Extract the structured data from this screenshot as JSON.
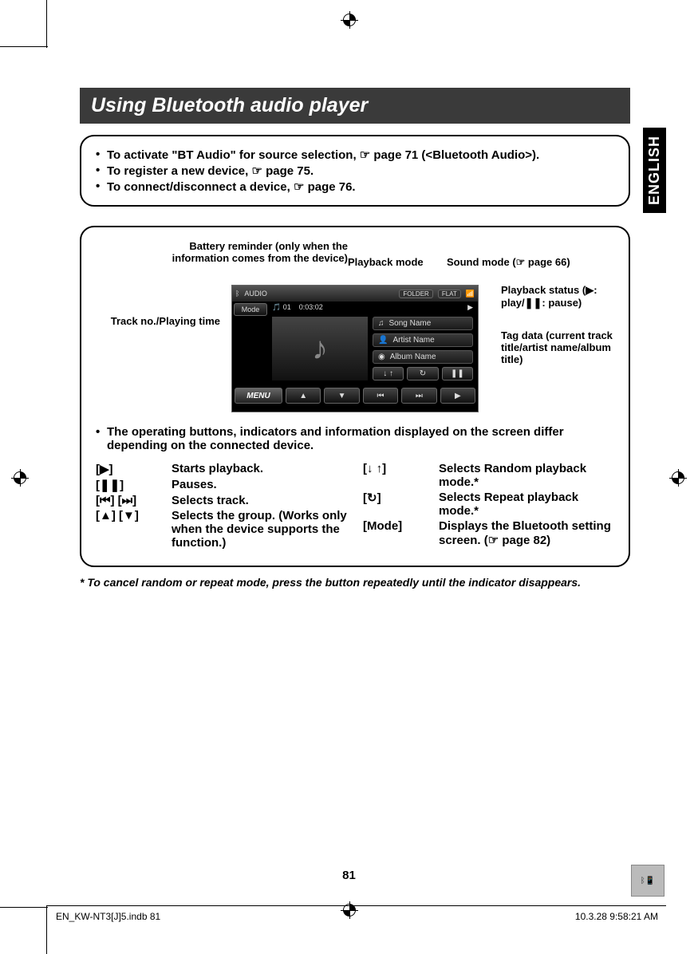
{
  "sideTab": "ENGLISH",
  "title": "Using Bluetooth audio player",
  "notes": {
    "n1_pre": "To activate \"BT Audio\" for source selection, ",
    "n1_ref": "☞ page 71 (<",
    "n1_bold": "Bluetooth Audio",
    "n1_post": ">).",
    "n2_pre": "To register a new device, ",
    "n2_ref": "☞ page 75.",
    "n3_pre": "To connect/disconnect a device, ",
    "n3_ref": "☞ page 76."
  },
  "callouts": {
    "battery": "Battery reminder (only when the information comes from the device)",
    "playback_mode": "Playback mode",
    "sound_mode": "Sound mode (☞ page 66)",
    "playback_status": "Playback status (▶: play/❚❚: pause)",
    "track": "Track no./Playing time",
    "tag": "Tag data (current track title/artist name/album title)"
  },
  "screen": {
    "source": "AUDIO",
    "folder_label": "FOLDER",
    "flat": "FLAT",
    "track_no": "01",
    "time": "0:03:02",
    "song": "Song Name",
    "artist": "Artist Name",
    "album": "Album Name",
    "mode_btn": "Mode",
    "menu_btn": "MENU"
  },
  "op_note": "The operating buttons, indicators and information displayed on the screen differ depending on the connected device.",
  "controls_left": [
    {
      "key": "[▶]",
      "desc": "Starts playback."
    },
    {
      "key": "[❚❚]",
      "desc": "Pauses."
    },
    {
      "key": "[⏮] [⏭]",
      "desc": "Selects track."
    },
    {
      "key": "[▲] [▼]",
      "desc": "Selects the group. (Works only when the device supports the function.)"
    }
  ],
  "controls_right": [
    {
      "key": "[↓ ↑]",
      "desc": "Selects Random playback mode.*"
    },
    {
      "key": "[↻]",
      "desc": "Selects Repeat playback mode.*"
    },
    {
      "key": "[Mode]",
      "desc": "Displays the Bluetooth setting screen. (☞ page 82)"
    }
  ],
  "footnote": "*  To cancel random or repeat mode, press the button repeatedly until the indicator disappears.",
  "page_number": "81",
  "footer_file": "EN_KW-NT3[J]5.indb   81",
  "footer_date": "10.3.28   9:58:21 AM"
}
